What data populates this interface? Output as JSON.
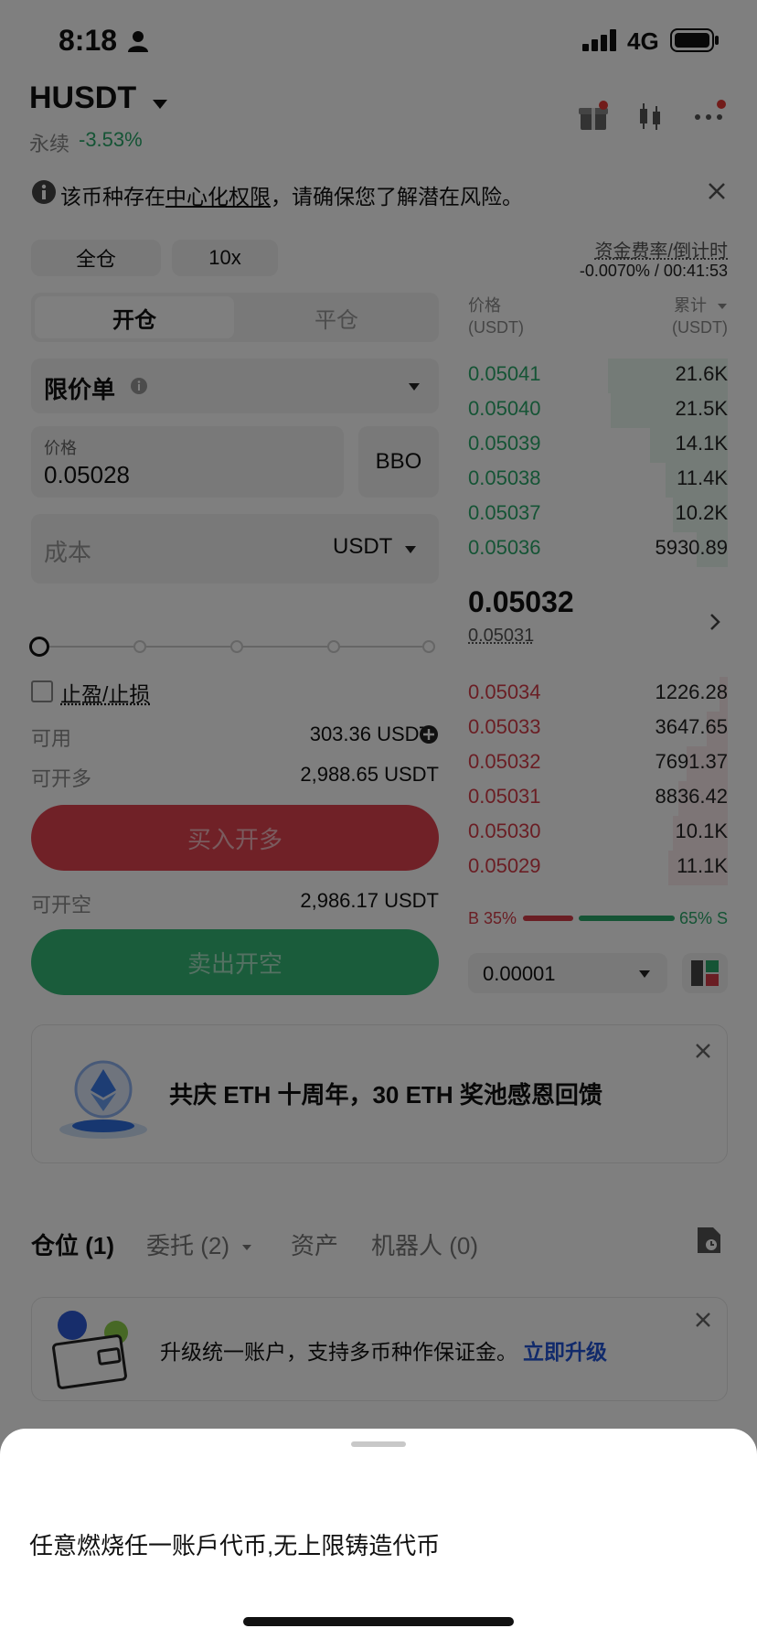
{
  "status_bar": {
    "time": "8:18",
    "network": "4G"
  },
  "header": {
    "symbol": "HUSDT",
    "contract_type": "永续",
    "change": "-3.53%"
  },
  "risk_notice": {
    "prefix": "该币种存在",
    "link": "中心化权限",
    "suffix": "，请确保您了解潜在风险。"
  },
  "margin_mode": "全仓",
  "leverage": "10x",
  "funding": {
    "label": "资金费率/倒计时",
    "value": "-0.0070% / 00:41:53"
  },
  "tabs": {
    "open": "开仓",
    "close": "平仓"
  },
  "order_type": "限价单",
  "price_field": {
    "label": "价格",
    "value": "0.05028",
    "bbo": "BBO"
  },
  "cost_field": {
    "placeholder": "成本",
    "unit": "USDT"
  },
  "slider": {
    "value_percent": 0
  },
  "tp_sl": "止盈/止损",
  "available": {
    "label": "可用",
    "value": "303.36 USDT"
  },
  "max_long": {
    "label": "可开多",
    "value": "2,988.65 USDT"
  },
  "buy_button": "买入开多",
  "max_short": {
    "label": "可开空",
    "value": "2,986.17 USDT"
  },
  "sell_button": "卖出开空",
  "orderbook": {
    "price_header": "价格",
    "price_unit": "(USDT)",
    "amount_header": "累计",
    "amount_unit": "(USDT)",
    "asks": [
      {
        "price": "0.05041",
        "amount": "21.6K",
        "depth": 0.46
      },
      {
        "price": "0.05040",
        "amount": "21.5K",
        "depth": 0.45
      },
      {
        "price": "0.05039",
        "amount": "14.1K",
        "depth": 0.3
      },
      {
        "price": "0.05038",
        "amount": "11.4K",
        "depth": 0.24
      },
      {
        "price": "0.05037",
        "amount": "10.2K",
        "depth": 0.21
      },
      {
        "price": "0.05036",
        "amount": "5930.89",
        "depth": 0.12
      }
    ],
    "last_price": "0.05032",
    "mark_price": "0.05031",
    "bids": [
      {
        "price": "0.05034",
        "amount": "1226.28",
        "depth": 0.03
      },
      {
        "price": "0.05033",
        "amount": "3647.65",
        "depth": 0.08
      },
      {
        "price": "0.05032",
        "amount": "7691.37",
        "depth": 0.16
      },
      {
        "price": "0.05031",
        "amount": "8836.42",
        "depth": 0.19
      },
      {
        "price": "0.05030",
        "amount": "10.1K",
        "depth": 0.21
      },
      {
        "price": "0.05029",
        "amount": "11.1K",
        "depth": 0.23
      }
    ],
    "ratio": {
      "buy_label": "B 35%",
      "sell_label": "65% S",
      "buy": 0.35,
      "sell": 0.65
    },
    "precision": "0.00001"
  },
  "promo": {
    "text": "共庆 ETH 十周年，30 ETH 奖池感恩回馈"
  },
  "position_tabs": [
    "仓位 (1)",
    "委托 (2)",
    "资产",
    "机器人 (0)"
  ],
  "upgrade_banner": {
    "text": "升级统一账户，支持多币种作保证金。",
    "link": "立即升级"
  },
  "bottom_sheet": {
    "text": "任意燃烧任一账戶代币,无上限铸造代币"
  },
  "colors": {
    "green": "#2aa86b",
    "red": "#d43c48",
    "link_blue": "#2354d6"
  }
}
